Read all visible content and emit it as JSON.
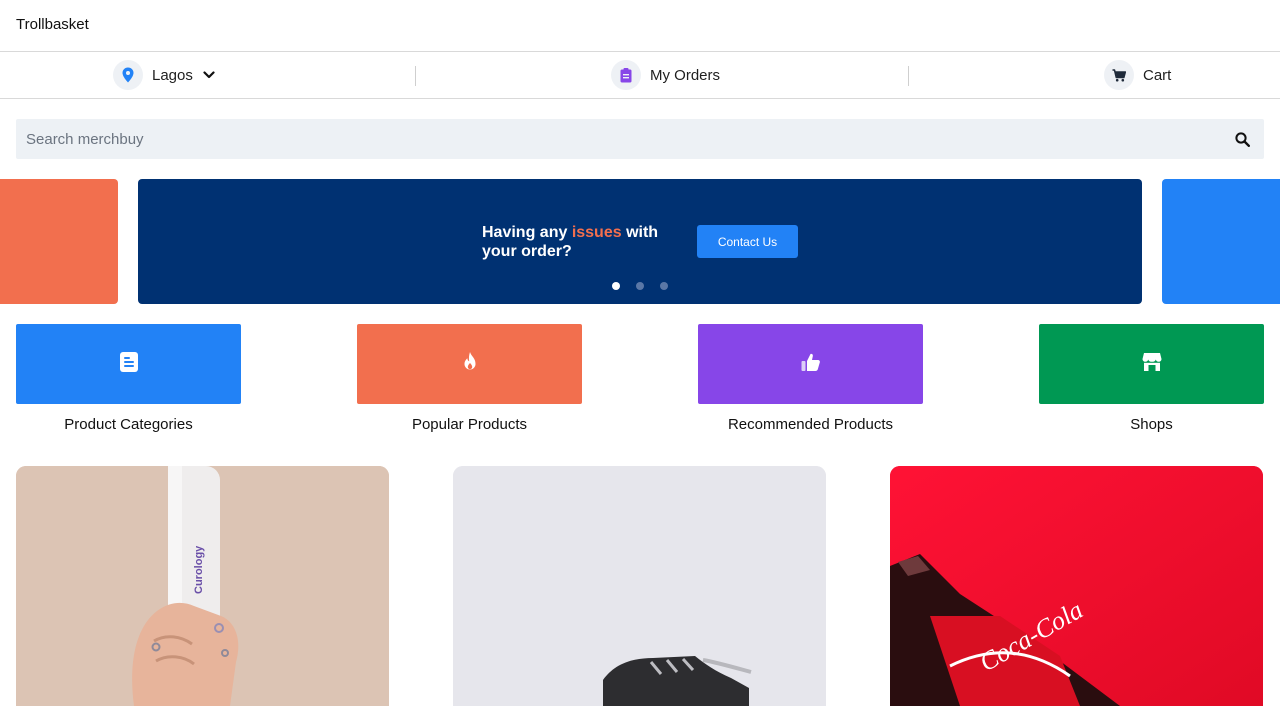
{
  "app": {
    "brand": "Trollbasket"
  },
  "nav": {
    "location": "Lagos",
    "orders_label": "My Orders",
    "cart_label": "Cart"
  },
  "search": {
    "placeholder": "Search merchbuy"
  },
  "banner": {
    "text_before": "Having any ",
    "text_accent": "issues",
    "text_after": " with your order?",
    "button_label": "Contact Us",
    "active_dot": 1,
    "dot_count": 3
  },
  "tiles": [
    {
      "label": "Product Categories",
      "color": "#2282f6",
      "icon": "document-icon"
    },
    {
      "label": "Popular Products",
      "color": "#f26f4e",
      "icon": "flame-icon"
    },
    {
      "label": "Recommended Products",
      "color": "#8746e8",
      "icon": "thumbs-up-icon"
    },
    {
      "label": "Shops",
      "color": "#009853",
      "icon": "storefront-icon"
    }
  ],
  "products": [
    {
      "image": "curology-bottle-image",
      "brand_text": "Curology"
    },
    {
      "image": "sneaker-image"
    },
    {
      "image": "coca-cola-bottle-image",
      "brand_text": "Coca-Cola"
    }
  ],
  "colors": {
    "banner_bg": "#003172",
    "accent": "#f26f4e",
    "primary": "#2282f6"
  }
}
